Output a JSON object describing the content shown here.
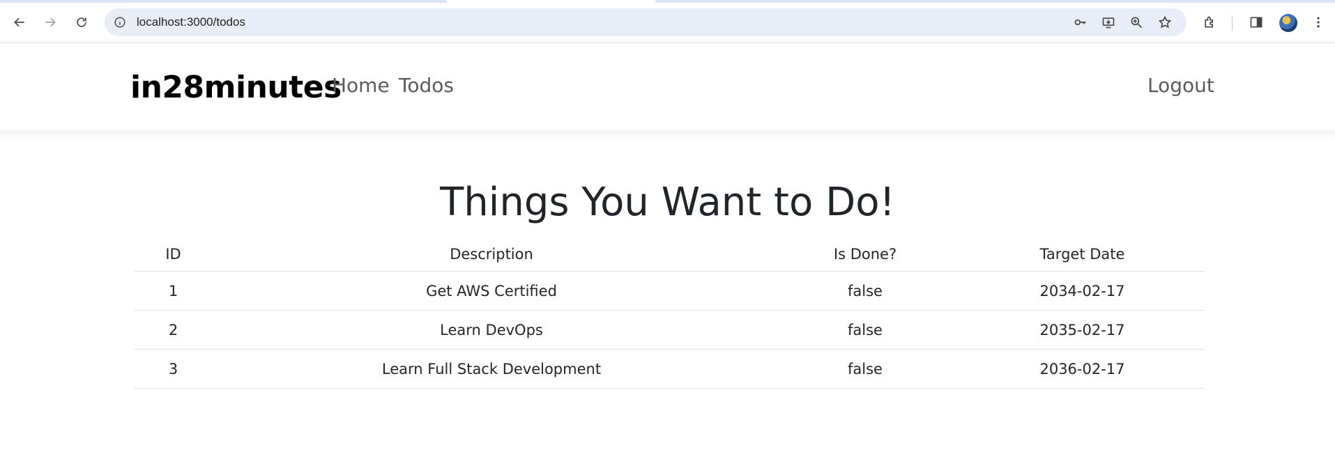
{
  "browser": {
    "url": "localhost:3000/todos"
  },
  "navbar": {
    "brand": "in28minutes",
    "links": [
      {
        "label": "Home"
      },
      {
        "label": "Todos"
      }
    ],
    "logout_label": "Logout"
  },
  "main": {
    "title": "Things You Want to Do!",
    "columns": [
      "ID",
      "Description",
      "Is Done?",
      "Target Date"
    ],
    "rows": [
      {
        "id": "1",
        "description": "Get AWS Certified",
        "done": "false",
        "target_date": "2034-02-17"
      },
      {
        "id": "2",
        "description": "Learn DevOps",
        "done": "false",
        "target_date": "2035-02-17"
      },
      {
        "id": "3",
        "description": "Learn Full Stack Development",
        "done": "false",
        "target_date": "2036-02-17"
      }
    ]
  }
}
